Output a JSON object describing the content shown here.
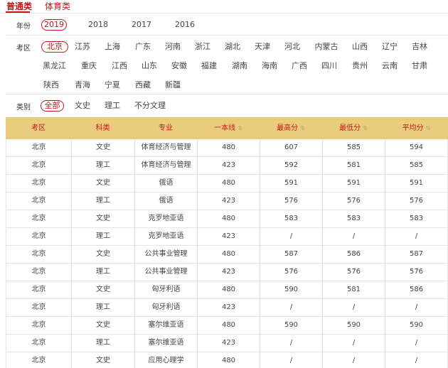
{
  "tabs": [
    "普通类",
    "体育类"
  ],
  "year": {
    "label": "年份",
    "options": [
      "2019",
      "2018",
      "2017",
      "2016"
    ],
    "selected": "2019"
  },
  "region": {
    "label": "考区",
    "options": [
      "北京",
      "江苏",
      "上海",
      "广东",
      "河南",
      "浙江",
      "湖北",
      "天津",
      "河北",
      "内蒙古",
      "山西",
      "辽宁",
      "吉林",
      "黑龙江",
      "重庆",
      "江西",
      "山东",
      "安徽",
      "福建",
      "湖南",
      "海南",
      "广西",
      "四川",
      "贵州",
      "云南",
      "甘肃",
      "陕西",
      "青海",
      "宁夏",
      "西藏",
      "新疆"
    ],
    "selected": "北京"
  },
  "category": {
    "label": "类别",
    "options": [
      "全部",
      "文史",
      "理工",
      "不分文理"
    ],
    "selected": "全部"
  },
  "table": {
    "headers": [
      "考区",
      "科类",
      "专业",
      "一本线",
      "最高分",
      "最低分",
      "平均分"
    ],
    "sortable": [
      false,
      false,
      false,
      true,
      true,
      true,
      true
    ],
    "rows": [
      [
        "北京",
        "文史",
        "体育经济与管理",
        "480",
        "607",
        "585",
        "594"
      ],
      [
        "北京",
        "理工",
        "体育经济与管理",
        "423",
        "592",
        "581",
        "585"
      ],
      [
        "北京",
        "文史",
        "俄语",
        "480",
        "591",
        "591",
        "591"
      ],
      [
        "北京",
        "理工",
        "俄语",
        "423",
        "576",
        "576",
        "576"
      ],
      [
        "北京",
        "文史",
        "克罗地亚语",
        "480",
        "583",
        "583",
        "583"
      ],
      [
        "北京",
        "理工",
        "克罗地亚语",
        "423",
        "/",
        "/",
        "/"
      ],
      [
        "北京",
        "文史",
        "公共事业管理",
        "480",
        "587",
        "586",
        "587"
      ],
      [
        "北京",
        "理工",
        "公共事业管理",
        "423",
        "576",
        "576",
        "576"
      ],
      [
        "北京",
        "文史",
        "匈牙利语",
        "480",
        "590",
        "581",
        "586"
      ],
      [
        "北京",
        "理工",
        "匈牙利语",
        "423",
        "/",
        "/",
        "/"
      ],
      [
        "北京",
        "文史",
        "塞尔维亚语",
        "480",
        "590",
        "590",
        "590"
      ],
      [
        "北京",
        "理工",
        "塞尔维亚语",
        "423",
        "/",
        "/",
        "/"
      ],
      [
        "北京",
        "文史",
        "应用心理学",
        "480",
        "/",
        "/",
        "/"
      ]
    ]
  },
  "colors": {
    "accent": "#c4161c",
    "header_bg": "#e9cc7d"
  }
}
